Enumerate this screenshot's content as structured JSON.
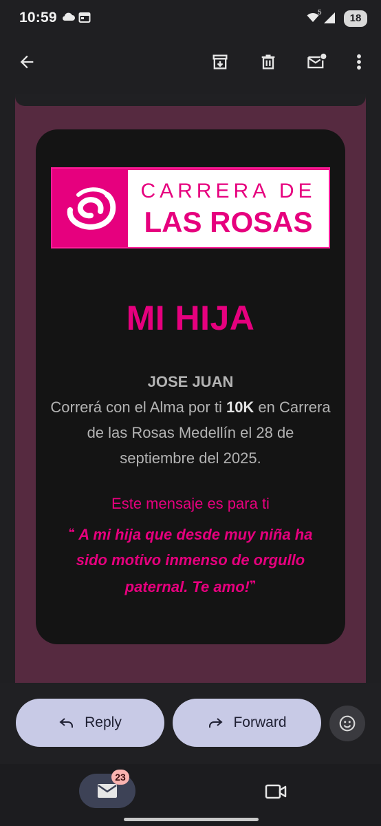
{
  "status_bar": {
    "time": "10:59",
    "network_label": "5",
    "battery": "18"
  },
  "app_bar": {
    "icons": [
      "back-arrow-icon",
      "archive-icon",
      "delete-icon",
      "mark-unread-icon",
      "more-vert-icon"
    ]
  },
  "email": {
    "logo": {
      "line1": "CARRERA DE",
      "line2": "LAS ROSAS"
    },
    "headline": "MI HIJA",
    "runner_name": "JOSE JUAN",
    "sentence_before_distance": "Correrá con el Alma por ti ",
    "distance": "10K",
    "sentence_after_distance": " en Carrera de las Rosas Medellín el 28 de septiembre del 2025.",
    "message_intro": "Este mensaje es para ti",
    "quote_open": "❝",
    "quote": "A mi hija que desde muy niña ha sido motivo inmenso de orgullo paternal. Te amo!",
    "quote_close": "❞",
    "colors": {
      "brand": "#e6007e",
      "frame": "#562a40",
      "card": "#141414"
    }
  },
  "actions": {
    "reply_label": "Reply",
    "forward_label": "Forward"
  },
  "bottom_nav": {
    "mail_badge": "23"
  }
}
